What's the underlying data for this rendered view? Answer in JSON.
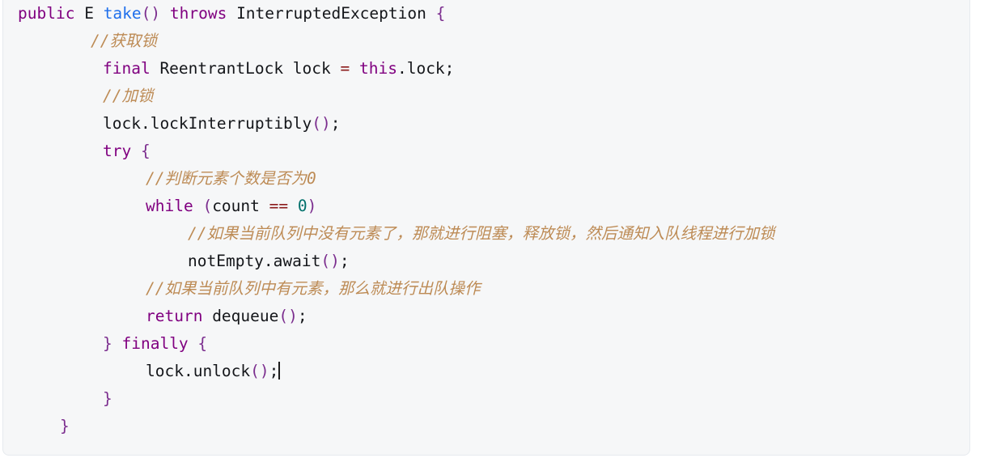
{
  "editor": {
    "language": "java",
    "background_color": "#f6f7f8",
    "caret_visible": true,
    "theme": {
      "keyword_color": "#800080",
      "method_color": "#1f6feb",
      "identifier_color": "#14161a",
      "punctuation_color": "#7b2d8e",
      "operator_color": "#8b1a1a",
      "number_color": "#00706b",
      "comment_color": "#bd8b55"
    }
  },
  "code": {
    "line1": {
      "kw_public": "public",
      "type_E": " E ",
      "fn_take": "take",
      "parens": "()",
      "kw_throws": " throws ",
      "type_exception": "InterruptedException",
      "brace_open": " {"
    },
    "line2": {
      "comment": "//获取锁"
    },
    "line3": {
      "kw_final": "final",
      "type_lock": " ReentrantLock lock ",
      "op_assign": "=",
      "kw_this": " this",
      "member": ".lock;"
    },
    "line4": {
      "comment": "//加锁"
    },
    "line5": {
      "call": "lock.lockInterruptibly",
      "parens": "()",
      "semi": ";"
    },
    "line6": {
      "kw_try": "try",
      "brace_open": " {"
    },
    "line7": {
      "comment": "//判断元素个数是否为0"
    },
    "line8": {
      "kw_while": "while",
      "paren_open": " (",
      "ident_count": "count ",
      "op_eq": "==",
      "space": " ",
      "num_zero": "0",
      "paren_close": ")"
    },
    "line9": {
      "comment": "//如果当前队列中没有元素了，那就进行阻塞，释放锁，然后通知入队线程进行加锁"
    },
    "line10": {
      "call": "notEmpty.await",
      "parens": "()",
      "semi": ";"
    },
    "line11": {
      "comment": "//如果当前队列中有元素，那么就进行出队操作"
    },
    "line12": {
      "kw_return": "return",
      "call": " dequeue",
      "parens": "()",
      "semi": ";"
    },
    "line13": {
      "brace_close": "}",
      "kw_finally": " finally",
      "brace_open": " {"
    },
    "line14": {
      "call": "lock.unlock",
      "parens": "()",
      "semi": ";"
    },
    "line15": {
      "brace_close": "}"
    },
    "line16": {
      "brace_close": "}"
    }
  }
}
